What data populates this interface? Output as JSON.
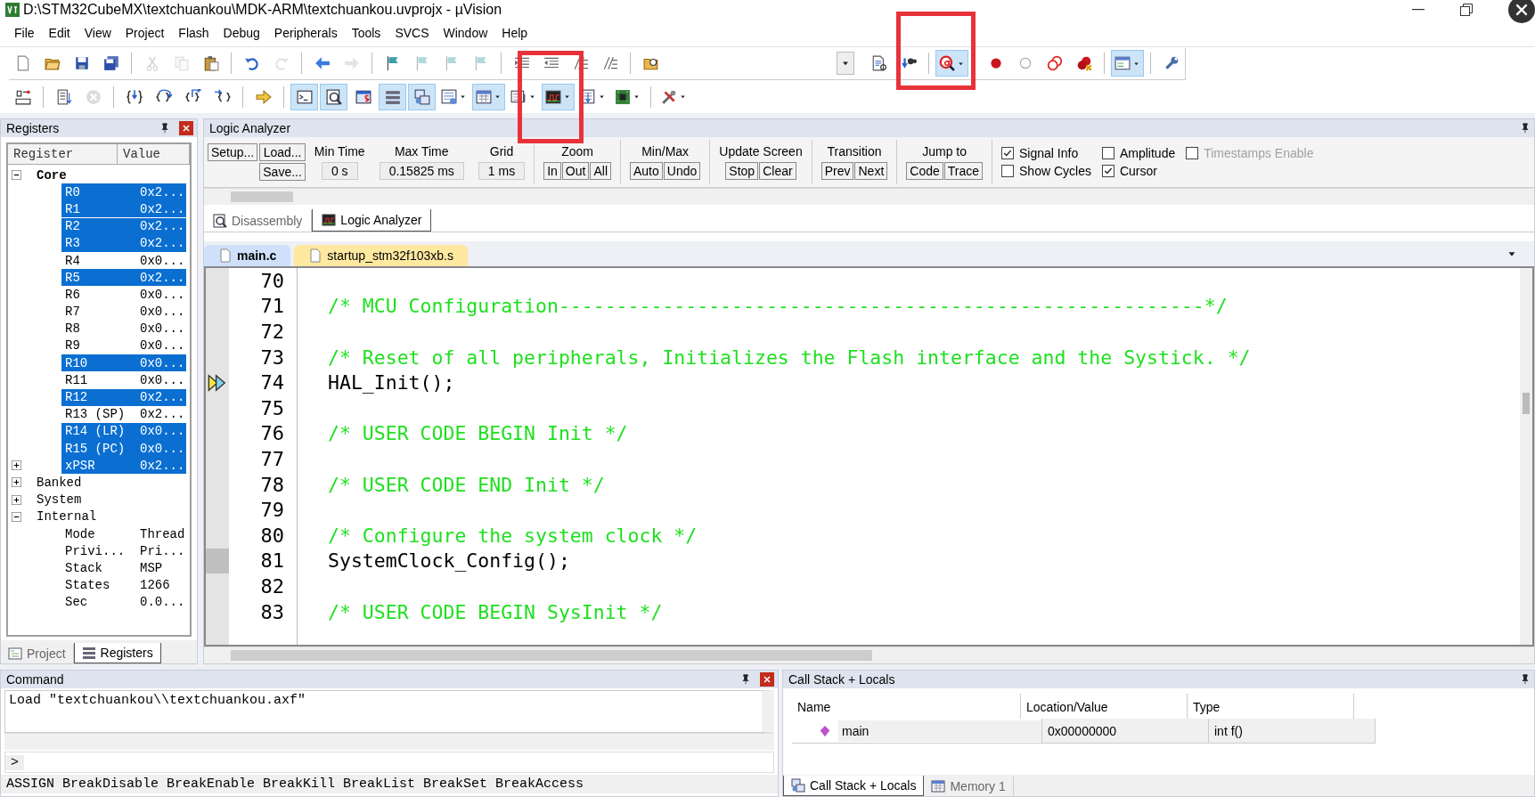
{
  "window": {
    "title": "D:\\STM32CubeMX\\textchuankou\\MDK-ARM\\textchuankou.uvprojx - µVision"
  },
  "menu": [
    "File",
    "Edit",
    "View",
    "Project",
    "Flash",
    "Debug",
    "Peripherals",
    "Tools",
    "SVCS",
    "Window",
    "Help"
  ],
  "toolbar_1": [
    {
      "kind": "new-file",
      "pressed": false,
      "dropdown": false,
      "disabled": false
    },
    {
      "kind": "open",
      "pressed": false,
      "dropdown": false,
      "disabled": false
    },
    {
      "kind": "save",
      "pressed": false,
      "dropdown": false,
      "disabled": false
    },
    {
      "kind": "save-all",
      "pressed": false,
      "dropdown": false,
      "disabled": false
    },
    {
      "kind": "separator"
    },
    {
      "kind": "cut",
      "pressed": false,
      "dropdown": false,
      "disabled": true
    },
    {
      "kind": "copy",
      "pressed": false,
      "dropdown": false,
      "disabled": true
    },
    {
      "kind": "paste",
      "pressed": false,
      "dropdown": false,
      "disabled": false
    },
    {
      "kind": "separator"
    },
    {
      "kind": "undo",
      "pressed": false,
      "dropdown": false,
      "disabled": false
    },
    {
      "kind": "redo",
      "pressed": false,
      "dropdown": false,
      "disabled": true
    },
    {
      "kind": "separator"
    },
    {
      "kind": "back",
      "pressed": false,
      "dropdown": false,
      "disabled": false
    },
    {
      "kind": "forward",
      "pressed": false,
      "dropdown": false,
      "disabled": true
    },
    {
      "kind": "separator"
    },
    {
      "kind": "flag",
      "pressed": false,
      "dropdown": false,
      "disabled": false
    },
    {
      "kind": "flag",
      "pressed": false,
      "dropdown": false,
      "disabled": true
    },
    {
      "kind": "flag",
      "pressed": false,
      "dropdown": false,
      "disabled": true
    },
    {
      "kind": "flag",
      "pressed": false,
      "dropdown": false,
      "disabled": true
    },
    {
      "kind": "separator"
    },
    {
      "kind": "indent",
      "pressed": false,
      "dropdown": false,
      "disabled": false
    },
    {
      "kind": "unindent",
      "pressed": false,
      "dropdown": false,
      "disabled": false
    },
    {
      "kind": "comment",
      "pressed": false,
      "dropdown": false,
      "disabled": false
    },
    {
      "kind": "comment",
      "pressed": false,
      "dropdown": false,
      "disabled": false
    },
    {
      "kind": "separator"
    },
    {
      "kind": "find-folder",
      "pressed": false,
      "dropdown": false,
      "disabled": false
    },
    {
      "kind": "combo"
    },
    {
      "kind": "find-doc",
      "pressed": false,
      "dropdown": false,
      "disabled": false
    },
    {
      "kind": "binoculars",
      "pressed": false,
      "dropdown": false,
      "disabled": false
    },
    {
      "kind": "separator"
    },
    {
      "kind": "debug",
      "pressed": true,
      "dropdown": true,
      "disabled": false
    },
    {
      "kind": "separator"
    },
    {
      "kind": "breakpoint",
      "pressed": false,
      "dropdown": false,
      "disabled": false
    },
    {
      "kind": "breakpoint-empty",
      "pressed": false,
      "dropdown": false,
      "disabled": false
    },
    {
      "kind": "breakpoints",
      "pressed": false,
      "dropdown": false,
      "disabled": false
    },
    {
      "kind": "breakpoint-kill",
      "pressed": false,
      "dropdown": false,
      "disabled": false
    },
    {
      "kind": "separator"
    },
    {
      "kind": "window",
      "pressed": true,
      "dropdown": true,
      "disabled": false
    },
    {
      "kind": "separator"
    },
    {
      "kind": "wrench",
      "pressed": false,
      "dropdown": false,
      "disabled": false
    }
  ],
  "toolbar_2": [
    {
      "kind": "reset",
      "pressed": false,
      "dropdown": false,
      "disabled": false
    },
    {
      "kind": "separator"
    },
    {
      "kind": "step-list",
      "pressed": false,
      "dropdown": false,
      "disabled": false
    },
    {
      "kind": "stop",
      "pressed": false,
      "dropdown": false,
      "disabled": true
    },
    {
      "kind": "separator"
    },
    {
      "kind": "step-into",
      "pressed": false,
      "dropdown": false,
      "disabled": false
    },
    {
      "kind": "step-over",
      "pressed": false,
      "dropdown": false,
      "disabled": false
    },
    {
      "kind": "step-out",
      "pressed": false,
      "dropdown": false,
      "disabled": false
    },
    {
      "kind": "run-cursor",
      "pressed": false,
      "dropdown": false,
      "disabled": false
    },
    {
      "kind": "separator"
    },
    {
      "kind": "show-next",
      "pressed": false,
      "dropdown": false,
      "disabled": false
    },
    {
      "kind": "separator"
    },
    {
      "kind": "terminal",
      "pressed": true,
      "dropdown": false,
      "disabled": false
    },
    {
      "kind": "disassembly",
      "pressed": true,
      "dropdown": false,
      "disabled": false
    },
    {
      "kind": "symbols",
      "pressed": false,
      "dropdown": false,
      "disabled": false
    },
    {
      "kind": "registers",
      "pressed": true,
      "dropdown": false,
      "disabled": false
    },
    {
      "kind": "call-stack",
      "pressed": true,
      "dropdown": false,
      "disabled": false
    },
    {
      "kind": "watch",
      "pressed": false,
      "dropdown": true,
      "disabled": false
    },
    {
      "kind": "memory",
      "pressed": true,
      "dropdown": true,
      "disabled": false
    },
    {
      "kind": "serial",
      "pressed": false,
      "dropdown": true,
      "disabled": false
    },
    {
      "kind": "analyzer",
      "pressed": true,
      "dropdown": true,
      "disabled": false
    },
    {
      "kind": "trace",
      "pressed": false,
      "dropdown": true,
      "disabled": false
    },
    {
      "kind": "chip",
      "pressed": false,
      "dropdown": true,
      "disabled": false
    },
    {
      "kind": "separator"
    },
    {
      "kind": "toolbox",
      "pressed": false,
      "dropdown": true,
      "disabled": false
    }
  ],
  "annotations": [
    {
      "kind": "highlight-box"
    },
    {
      "kind": "highlight-box"
    }
  ],
  "registers_panel": {
    "title": "Registers",
    "columns": [
      "Register",
      "Value"
    ],
    "tree": [
      {
        "name": "Core",
        "active": true,
        "expanded": true,
        "children": [
          {
            "name": "R0",
            "value": "0x2...",
            "selected": true
          },
          {
            "name": "R1",
            "value": "0x2...",
            "selected": true
          },
          {
            "name": "R2",
            "value": "0x2...",
            "selected": true
          },
          {
            "name": "R3",
            "value": "0x2...",
            "selected": true
          },
          {
            "name": "R4",
            "value": "0x0...",
            "selected": false
          },
          {
            "name": "R5",
            "value": "0x2...",
            "selected": true
          },
          {
            "name": "R6",
            "value": "0x0...",
            "selected": false
          },
          {
            "name": "R7",
            "value": "0x0...",
            "selected": false
          },
          {
            "name": "R8",
            "value": "0x0...",
            "selected": false
          },
          {
            "name": "R9",
            "value": "0x0...",
            "selected": false
          },
          {
            "name": "R10",
            "value": "0x0...",
            "selected": true
          },
          {
            "name": "R11",
            "value": "0x0...",
            "selected": false
          },
          {
            "name": "R12",
            "value": "0x2...",
            "selected": true
          },
          {
            "name": "R13 (SP)",
            "value": "0x2...",
            "selected": false
          },
          {
            "name": "R14 (LR)",
            "value": "0x0...",
            "selected": true
          },
          {
            "name": "R15 (PC)",
            "value": "0x0...",
            "selected": true
          },
          {
            "name": "xPSR",
            "value": "0x2...",
            "selected": true,
            "expanded": false
          }
        ]
      },
      {
        "name": "Banked",
        "active": false,
        "expanded": false
      },
      {
        "name": "System",
        "active": false,
        "expanded": false
      },
      {
        "name": "Internal",
        "active": false,
        "expanded": true,
        "children": [
          {
            "name": "Mode",
            "value": "Thread",
            "selected": false
          },
          {
            "name": "Privi...",
            "value": "Pri...",
            "selected": false
          },
          {
            "name": "Stack",
            "value": "MSP",
            "selected": false
          },
          {
            "name": "States",
            "value": "1266",
            "selected": false
          },
          {
            "name": "Sec",
            "value": "0.0...",
            "selected": false
          }
        ]
      }
    ],
    "tabs": [
      {
        "label": "Project",
        "selected": false
      },
      {
        "label": "Registers",
        "selected": true
      }
    ]
  },
  "logic_analyzer": {
    "title": "Logic Analyzer",
    "file_buttons": [
      "Setup...",
      "Load...",
      "Save..."
    ],
    "readouts": [
      {
        "label": "Min Time",
        "value": "0 s"
      },
      {
        "label": "Max Time",
        "value": "0.15825 ms"
      },
      {
        "label": "Grid",
        "value": "1 ms"
      }
    ],
    "button_groups": [
      {
        "label": "Zoom",
        "buttons": [
          "In",
          "Out",
          "All"
        ]
      },
      {
        "label": "Min/Max",
        "buttons": [
          "Auto",
          "Undo"
        ]
      },
      {
        "label": "Update Screen",
        "buttons": [
          "Stop",
          "Clear"
        ]
      },
      {
        "label": "Transition",
        "buttons": [
          "Prev",
          "Next"
        ]
      },
      {
        "label": "Jump to",
        "buttons": [
          "Code",
          "Trace"
        ]
      }
    ],
    "checkboxes": [
      {
        "label": "Signal Info",
        "checked": true,
        "disabled": false
      },
      {
        "label": "Amplitude",
        "checked": false,
        "disabled": false
      },
      {
        "label": "Timestamps Enable",
        "checked": false,
        "disabled": true
      },
      {
        "label": "Show Cycles",
        "checked": false,
        "disabled": false
      },
      {
        "label": "Cursor",
        "checked": true,
        "disabled": false
      }
    ]
  },
  "view_tabs": [
    {
      "label": "Disassembly",
      "selected": false
    },
    {
      "label": "Logic Analyzer",
      "selected": true
    }
  ],
  "file_tabs": [
    {
      "label": "main.c",
      "selected": true
    },
    {
      "label": "startup_stm32f103xb.s",
      "selected": false
    }
  ],
  "code": [
    {
      "number": "70",
      "kind": "code",
      "current": false,
      "executable": false
    },
    {
      "number": "71",
      "text": "/* MCU Configuration--------------------------------------------------------*/",
      "kind": "comment",
      "current": false,
      "executable": false
    },
    {
      "number": "72",
      "kind": "code",
      "current": false,
      "executable": false
    },
    {
      "number": "73",
      "text": "/* Reset of all peripherals, Initializes the Flash interface and the Systick. */",
      "kind": "comment",
      "current": false,
      "executable": false
    },
    {
      "number": "74",
      "text": "HAL_Init();",
      "kind": "code",
      "current": true,
      "executable": false
    },
    {
      "number": "75",
      "kind": "code",
      "current": false,
      "executable": false
    },
    {
      "number": "76",
      "text": "/* USER CODE BEGIN Init */",
      "kind": "comment",
      "current": false,
      "executable": false
    },
    {
      "number": "77",
      "kind": "code",
      "current": false,
      "executable": false
    },
    {
      "number": "78",
      "text": "/* USER CODE END Init */",
      "kind": "comment",
      "current": false,
      "executable": false
    },
    {
      "number": "79",
      "kind": "code",
      "current": false,
      "executable": false
    },
    {
      "number": "80",
      "text": "/* Configure the system clock */",
      "kind": "comment",
      "current": false,
      "executable": false
    },
    {
      "number": "81",
      "text": "SystemClock_Config();",
      "kind": "code",
      "current": false,
      "executable": true
    },
    {
      "number": "82",
      "kind": "code",
      "current": false,
      "executable": false
    },
    {
      "number": "83",
      "text": "/* USER CODE BEGIN SysInit */",
      "kind": "comment",
      "current": false,
      "executable": false
    }
  ],
  "command_panel": {
    "title": "Command",
    "output": "Load \"textchuankou\\\\textchuankou.axf\"",
    "prompt": ">",
    "help": "ASSIGN BreakDisable BreakEnable BreakKill BreakList BreakSet BreakAccess"
  },
  "call_stack_panel": {
    "title": "Call Stack + Locals",
    "columns": [
      "Name",
      "Location/Value",
      "Type"
    ],
    "rows": [
      {
        "name": "main",
        "location": "0x00000000",
        "type": "int f()"
      }
    ],
    "tabs": [
      {
        "label": "Call Stack + Locals",
        "selected": true
      },
      {
        "label": "Memory 1",
        "selected": false
      }
    ]
  }
}
